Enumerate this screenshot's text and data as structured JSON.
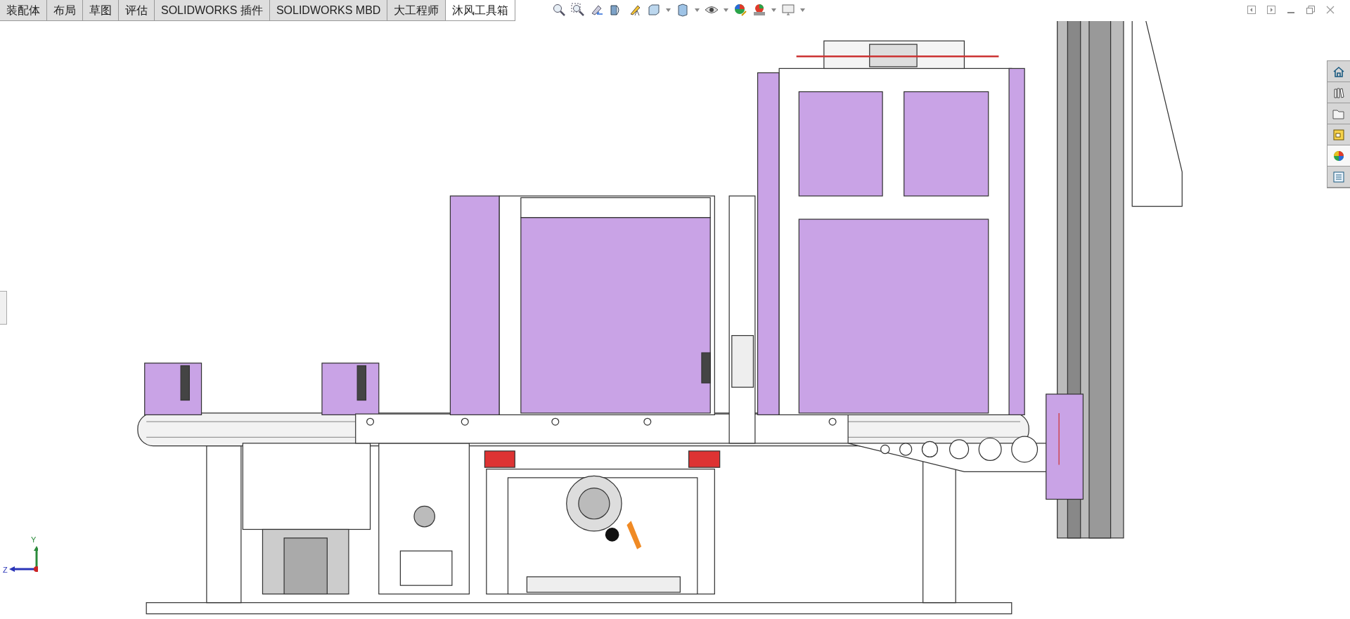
{
  "command_manager": {
    "tabs": [
      {
        "label": "装配体",
        "selected": false
      },
      {
        "label": "布局",
        "selected": false
      },
      {
        "label": "草图",
        "selected": false
      },
      {
        "label": "评估",
        "selected": false
      },
      {
        "label": "SOLIDWORKS 插件",
        "selected": false
      },
      {
        "label": "SOLIDWORKS MBD",
        "selected": false
      },
      {
        "label": "大工程师",
        "selected": false
      },
      {
        "label": "沐风工具箱",
        "selected": true
      }
    ]
  },
  "task_pane": {
    "items": [
      {
        "selected": false
      },
      {
        "selected": false
      },
      {
        "selected": false
      },
      {
        "selected": false
      },
      {
        "selected": true
      },
      {
        "selected": false
      }
    ]
  },
  "triad": {
    "y_label": "Y",
    "z_label": "Z"
  }
}
